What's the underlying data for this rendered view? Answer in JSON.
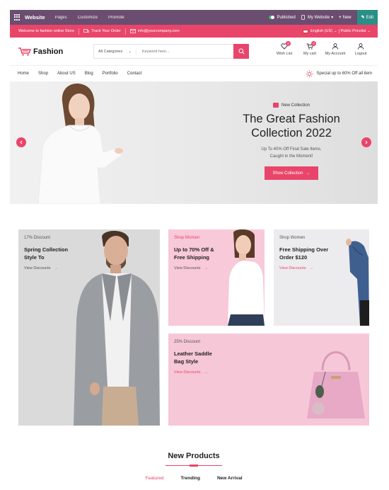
{
  "admin_bar": {
    "site": "Website",
    "menu": [
      "Pages",
      "Customize",
      "Promote"
    ],
    "published": "Published",
    "my_website": "My Website",
    "new": "New",
    "edit": "Edit"
  },
  "promo_bar": {
    "welcome": "Welcome to fashion online Store",
    "track": "Track Your Order",
    "email": "info@yourcompany.com",
    "language": "English (US)",
    "pricelist": "Public Pricelist"
  },
  "header": {
    "logo": "Fashion",
    "category": "All Categories",
    "search_placeholder": "Keyword here...",
    "icons": [
      {
        "label": "Wish List",
        "badge": "0"
      },
      {
        "label": "My cart",
        "badge": "0"
      },
      {
        "label": "My Account"
      },
      {
        "label": "Logout"
      }
    ]
  },
  "nav": {
    "items": [
      "Home",
      "Shop",
      "About US",
      "Blog",
      "Portfolio",
      "Contact"
    ],
    "special": "Special up to 60% Off all item"
  },
  "hero": {
    "tag": "New Collection",
    "title_line1": "The Great Fashion",
    "title_line2": "Collection 2022",
    "sub_line1": "Up To 40% Off Final Sale Items.",
    "sub_line2": "Caught in the Moment!",
    "cta": "Show Collection"
  },
  "cards": [
    {
      "small": "17% Discount",
      "title1": "Spring Collection",
      "title2": "Style To",
      "link": "View Discounts"
    },
    {
      "small": "Shop Women",
      "title1": "Up to 70% Off &",
      "title2": "Free Shipping",
      "link": "View Discounts"
    },
    {
      "small": "Shop Women",
      "title1": "Free Shipping Over",
      "title2": "Order $120",
      "link": "View Discounts"
    },
    {
      "small": "25% Discount",
      "title1": "Leather Saddle",
      "title2": "Bag Style",
      "link": "View Discounts"
    }
  ],
  "products": {
    "title": "New Products",
    "tabs": [
      "Featured",
      "Trending",
      "New Arrival"
    ]
  },
  "colors": {
    "accent": "#e9456a",
    "admin": "#6b4d6f"
  }
}
